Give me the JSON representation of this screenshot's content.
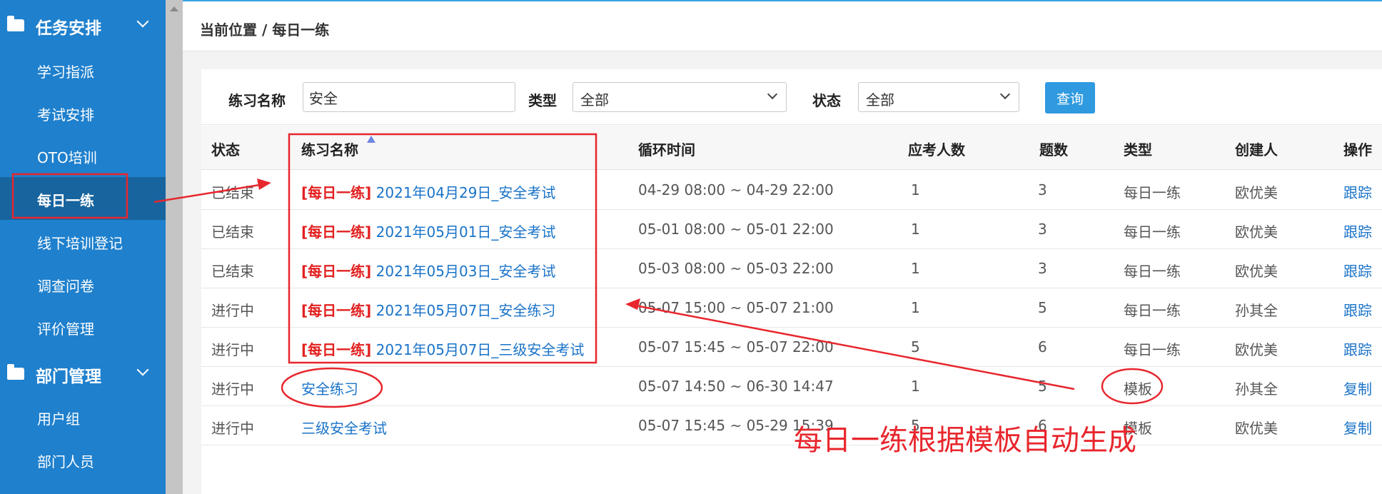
{
  "sidebar": {
    "groups": [
      {
        "label": "任务安排"
      },
      {
        "label": "部门管理"
      }
    ],
    "items": [
      {
        "label": "学习指派"
      },
      {
        "label": "考试安排"
      },
      {
        "label": "OTO培训"
      },
      {
        "label": "每日一练"
      },
      {
        "label": "线下培训登记"
      },
      {
        "label": "调查问卷"
      },
      {
        "label": "评价管理"
      },
      {
        "label": "用户组"
      },
      {
        "label": "部门人员"
      }
    ],
    "active_item": "每日一练"
  },
  "breadcrumb": "当前位置 / 每日一练",
  "filters": {
    "name_label": "练习名称",
    "name_value": "安全",
    "type_label": "类型",
    "type_value": "全部",
    "status_label": "状态",
    "status_value": "全部",
    "search_button": "查询"
  },
  "table": {
    "columns": [
      "状态",
      "练习名称",
      "循环时间",
      "应考人数",
      "题数",
      "类型",
      "创建人",
      "操作"
    ],
    "sort_column": "练习名称",
    "rows": [
      {
        "status": "已结束",
        "tag": "[每日一练]",
        "name": "2021年04月29日_安全考试",
        "time": "04-29 08:00 ~ 04-29 22:00",
        "examinees": "1",
        "questions": "3",
        "type": "每日一练",
        "creator": "欧优美",
        "action": "跟踪"
      },
      {
        "status": "已结束",
        "tag": "[每日一练]",
        "name": "2021年05月01日_安全考试",
        "time": "05-01 08:00 ~ 05-01 22:00",
        "examinees": "1",
        "questions": "3",
        "type": "每日一练",
        "creator": "欧优美",
        "action": "跟踪"
      },
      {
        "status": "已结束",
        "tag": "[每日一练]",
        "name": "2021年05月03日_安全考试",
        "time": "05-03 08:00 ~ 05-03 22:00",
        "examinees": "1",
        "questions": "3",
        "type": "每日一练",
        "creator": "欧优美",
        "action": "跟踪"
      },
      {
        "status": "进行中",
        "tag": "[每日一练]",
        "name": "2021年05月07日_安全练习",
        "time": "05-07 15:00 ~ 05-07 21:00",
        "examinees": "1",
        "questions": "5",
        "type": "每日一练",
        "creator": "孙其全",
        "action": "跟踪"
      },
      {
        "status": "进行中",
        "tag": "[每日一练]",
        "name": "2021年05月07日_三级安全考试",
        "time": "05-07 15:45 ~ 05-07 22:00",
        "examinees": "5",
        "questions": "6",
        "type": "每日一练",
        "creator": "欧优美",
        "action": "跟踪"
      },
      {
        "status": "进行中",
        "tag": "",
        "name": "安全练习",
        "time": "05-07 14:50 ~ 06-30 14:47",
        "examinees": "1",
        "questions": "5",
        "type": "模板",
        "creator": "孙其全",
        "action": "复制"
      },
      {
        "status": "进行中",
        "tag": "",
        "name": "三级安全考试",
        "time": "05-07 15:45 ~ 05-29 15:39",
        "examinees": "5",
        "questions": "6",
        "type": "模板",
        "creator": "欧优美",
        "action": "复制"
      }
    ]
  },
  "annotation": {
    "text": "每日一练根据模板自动生成",
    "color": "#e8262d"
  },
  "colors": {
    "sidebar_bg": "#1f80cd",
    "sidebar_active": "#17649f",
    "link": "#1a73c8",
    "tag_red": "#e2201f",
    "button_blue": "#2f9ae0"
  },
  "icons": [
    "folder-icon",
    "chevron-down-icon",
    "sort-up-icon",
    "select-arrow-icon",
    "scroll-up-icon"
  ]
}
